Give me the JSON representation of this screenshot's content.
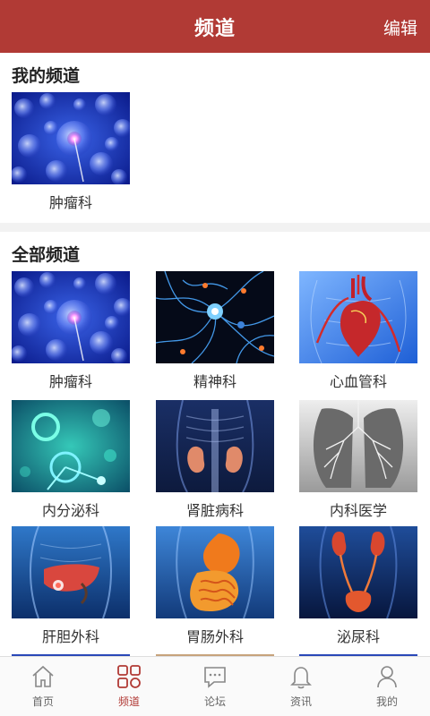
{
  "header": {
    "title": "频道",
    "edit_label": "编辑"
  },
  "my_channels": {
    "title": "我的频道",
    "items": [
      {
        "label": "肿瘤科",
        "image": "cells-image"
      }
    ]
  },
  "all_channels": {
    "title": "全部频道",
    "items": [
      {
        "label": "肿瘤科",
        "image": "cells-image"
      },
      {
        "label": "精神科",
        "image": "neurons-image"
      },
      {
        "label": "心血管科",
        "image": "heart-image"
      },
      {
        "label": "内分泌科",
        "image": "molecules-image"
      },
      {
        "label": "肾脏病科",
        "image": "kidney-image"
      },
      {
        "label": "内科医学",
        "image": "lungs-image"
      },
      {
        "label": "肝胆外科",
        "image": "liver-image"
      },
      {
        "label": "胃肠外科",
        "image": "stomach-image"
      },
      {
        "label": "泌尿科",
        "image": "urinary-image"
      }
    ]
  },
  "bottom_nav": {
    "items": [
      {
        "label": "首页",
        "icon": "home-icon"
      },
      {
        "label": "频道",
        "icon": "channel-grid-icon",
        "active": true
      },
      {
        "label": "论坛",
        "icon": "forum-chat-icon"
      },
      {
        "label": "资讯",
        "icon": "bell-icon"
      },
      {
        "label": "我的",
        "icon": "user-icon"
      }
    ]
  },
  "colors": {
    "brand": "#b13a35",
    "active_nav": "#b13a35",
    "text": "#333333"
  }
}
